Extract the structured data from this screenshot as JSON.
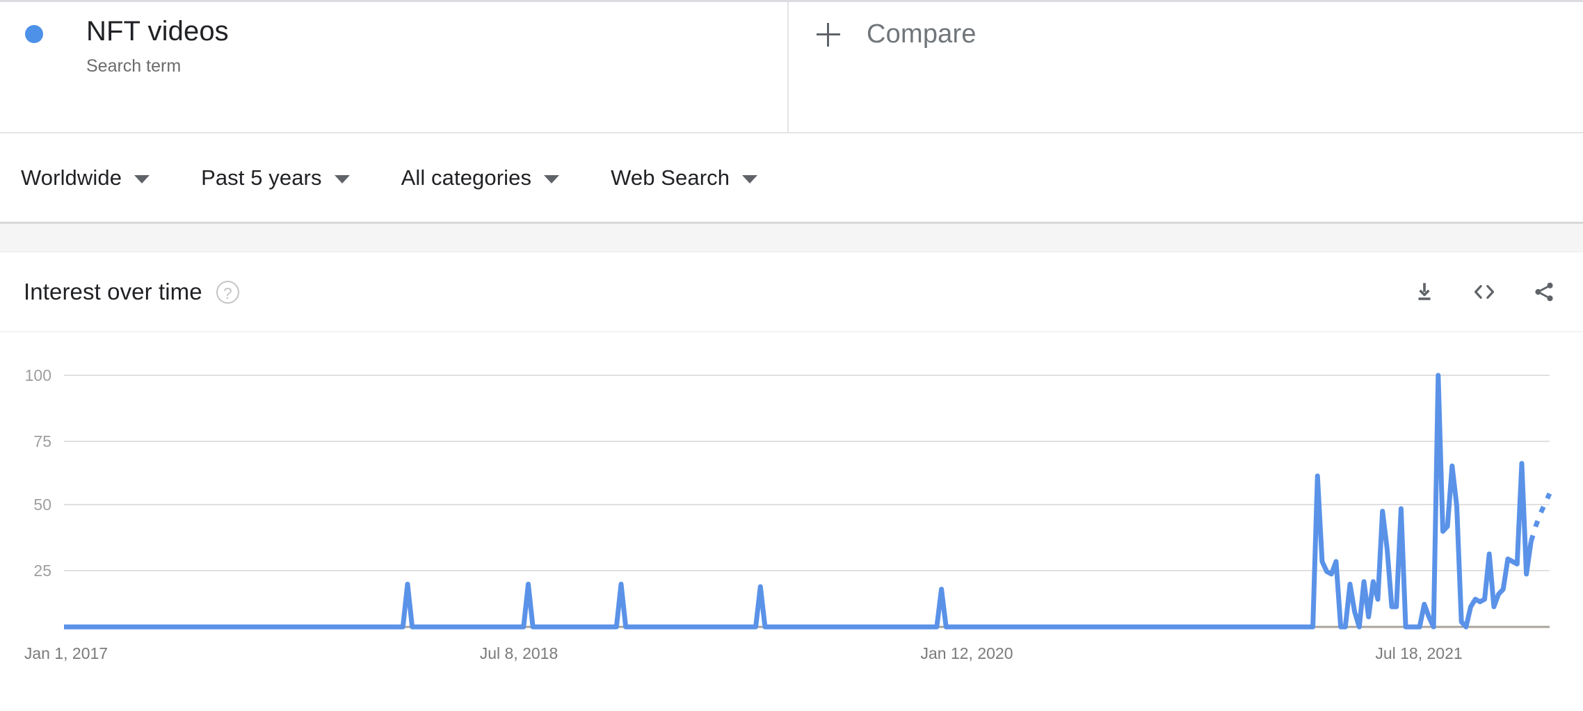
{
  "term": {
    "title": "NFT videos",
    "subtitle": "Search term",
    "dot_color": "#4d91e8"
  },
  "compare": {
    "label": "Compare",
    "icon": "plus-icon"
  },
  "filters": [
    {
      "label": "Worldwide",
      "name": "location"
    },
    {
      "label": "Past 5 years",
      "name": "time-range"
    },
    {
      "label": "All categories",
      "name": "category"
    },
    {
      "label": "Web Search",
      "name": "search-type"
    }
  ],
  "section": {
    "title": "Interest over time",
    "help": "?",
    "actions": [
      {
        "name": "download-icon",
        "label": "Download"
      },
      {
        "name": "embed-icon",
        "label": "Embed"
      },
      {
        "name": "share-icon",
        "label": "Share"
      }
    ]
  },
  "chart_data": {
    "type": "line",
    "title": "Interest over time",
    "xlabel": "",
    "ylabel": "",
    "ylim": [
      0,
      100
    ],
    "y_ticks": [
      100,
      75,
      50,
      25
    ],
    "x_ticks": [
      "Jan 1, 2017",
      "Jul 8, 2018",
      "Jan 12, 2020",
      "Jul 18, 2021"
    ],
    "x_tick_positions": [
      0,
      0.352,
      0.702,
      0.947
    ],
    "grid": true,
    "legend": "none",
    "line_color": "#5a92e8",
    "partial_data_dashed": true,
    "series": [
      {
        "name": "NFT videos",
        "values": [
          0,
          0,
          0,
          0,
          0,
          0,
          0,
          0,
          0,
          0,
          0,
          0,
          0,
          0,
          0,
          0,
          0,
          0,
          0,
          0,
          0,
          0,
          0,
          0,
          0,
          0,
          0,
          0,
          0,
          0,
          0,
          0,
          0,
          0,
          0,
          0,
          0,
          0,
          0,
          0,
          0,
          0,
          0,
          0,
          0,
          0,
          0,
          0,
          0,
          0,
          0,
          0,
          0,
          0,
          0,
          0,
          0,
          0,
          0,
          0,
          0,
          0,
          0,
          0,
          0,
          0,
          0,
          0,
          0,
          0,
          0,
          0,
          0,
          0,
          17,
          0,
          0,
          0,
          0,
          0,
          0,
          0,
          0,
          0,
          0,
          0,
          0,
          0,
          0,
          0,
          0,
          0,
          0,
          0,
          0,
          0,
          0,
          0,
          0,
          0,
          17,
          0,
          0,
          0,
          0,
          0,
          0,
          0,
          0,
          0,
          0,
          0,
          0,
          0,
          0,
          0,
          0,
          0,
          0,
          0,
          17,
          0,
          0,
          0,
          0,
          0,
          0,
          0,
          0,
          0,
          0,
          0,
          0,
          0,
          0,
          0,
          0,
          0,
          0,
          0,
          0,
          0,
          0,
          0,
          0,
          0,
          0,
          0,
          0,
          0,
          16,
          0,
          0,
          0,
          0,
          0,
          0,
          0,
          0,
          0,
          0,
          0,
          0,
          0,
          0,
          0,
          0,
          0,
          0,
          0,
          0,
          0,
          0,
          0,
          0,
          0,
          0,
          0,
          0,
          0,
          0,
          0,
          0,
          0,
          0,
          0,
          0,
          0,
          0,
          15,
          0,
          0,
          0,
          0,
          0,
          0,
          0,
          0,
          0,
          0,
          0,
          0,
          0,
          0,
          0,
          0,
          0,
          0,
          0,
          0,
          0,
          0,
          0,
          0,
          0,
          0,
          0,
          0,
          0,
          0,
          0,
          0,
          0,
          0,
          0,
          0,
          0,
          0,
          0,
          0,
          0,
          0,
          0,
          0,
          0,
          0,
          0,
          0,
          0,
          0,
          0,
          0,
          0,
          0,
          0,
          0,
          0,
          0,
          0,
          0,
          0,
          0,
          0,
          0,
          0,
          0,
          0,
          0,
          0,
          0,
          0,
          0,
          0,
          0,
          0,
          0,
          0,
          0,
          0,
          0,
          60,
          26,
          22,
          21,
          26,
          0,
          0,
          17,
          6,
          0,
          18,
          4,
          18,
          11,
          46,
          31,
          8,
          8,
          47,
          0,
          0,
          0,
          0,
          9,
          4,
          0,
          100,
          38,
          40,
          64,
          48,
          2,
          0,
          8,
          11,
          10,
          11,
          29,
          8,
          13,
          15,
          27,
          26,
          25,
          65,
          21,
          34
        ]
      }
    ],
    "partial_segment_values": [
      34,
      40,
      45,
      49,
      53
    ],
    "peak_value": 100,
    "note": "Final dashed segment indicates incomplete/partial data"
  }
}
